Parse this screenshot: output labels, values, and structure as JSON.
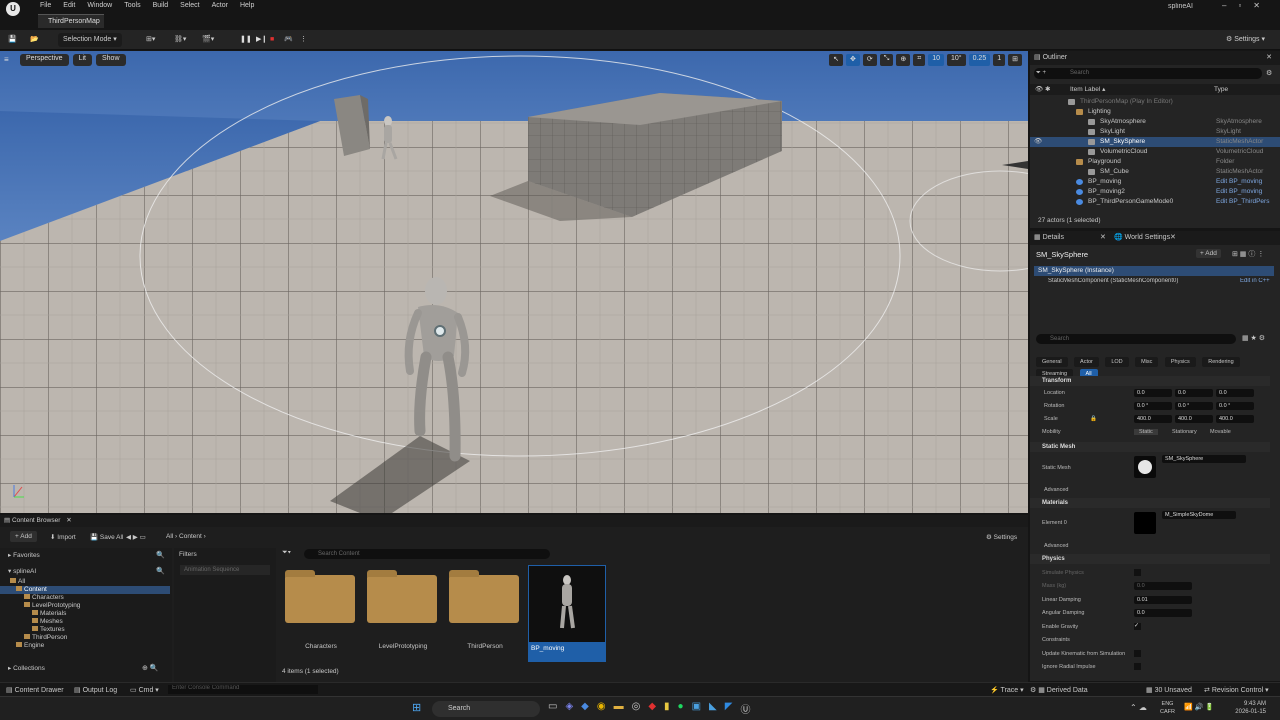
{
  "app": {
    "menus": [
      "File",
      "Edit",
      "Window",
      "Tools",
      "Build",
      "Select",
      "Actor",
      "Help"
    ],
    "map_tab": "ThirdPersonMap",
    "project": "splineAI",
    "window_controls": [
      "–",
      "▫",
      "✕"
    ]
  },
  "toolbar": {
    "selection_mode": "Selection Mode",
    "settings": "Settings"
  },
  "viewport": {
    "perspective": "Perspective",
    "lit": "Lit",
    "show": "Show",
    "grid": "10",
    "angle": "10°",
    "scale": "0.25",
    "cam": "1"
  },
  "outliner": {
    "title": "Outliner",
    "search_placeholder": "Search",
    "col_label": "Item Label ▴",
    "col_type": "Type",
    "rows": [
      {
        "label": "ThirdPersonMap (Play In Editor)",
        "type": "",
        "indent": 50,
        "icon": "🌐",
        "sel": false,
        "dim": true
      },
      {
        "label": "Lighting",
        "type": "",
        "indent": 58,
        "icon": "📁",
        "sel": false,
        "dim": false
      },
      {
        "label": "SkyAtmosphere",
        "type": "SkyAtmosphere",
        "indent": 70,
        "icon": "☁",
        "sel": false,
        "dim": false
      },
      {
        "label": "SkyLight",
        "type": "SkyLight",
        "indent": 70,
        "icon": "☀",
        "sel": false,
        "dim": false
      },
      {
        "label": "SM_SkySphere",
        "type": "StaticMeshActor",
        "indent": 70,
        "icon": "◆",
        "sel": true,
        "dim": false
      },
      {
        "label": "VolumetricCloud",
        "type": "VolumetricCloud",
        "indent": 70,
        "icon": "☁",
        "sel": false,
        "dim": false
      },
      {
        "label": "Playground",
        "type": "Folder",
        "indent": 58,
        "icon": "📁",
        "sel": false,
        "dim": false
      },
      {
        "label": "SM_Cube",
        "type": "StaticMeshActor",
        "indent": 70,
        "icon": "◆",
        "sel": false,
        "dim": false
      },
      {
        "label": "BP_moving",
        "type": "Edit BP_moving",
        "indent": 58,
        "icon": "●",
        "sel": false,
        "dim": false,
        "link": true
      },
      {
        "label": "BP_moving2",
        "type": "Edit BP_moving",
        "indent": 58,
        "icon": "●",
        "sel": false,
        "dim": false,
        "link": true
      },
      {
        "label": "BP_ThirdPersonGameMode0",
        "type": "Edit BP_ThirdPers",
        "indent": 58,
        "icon": "●",
        "sel": false,
        "dim": false,
        "link": true
      }
    ],
    "footer": "27 actors (1 selected)"
  },
  "details": {
    "tab_details": "Details",
    "tab_world": "World Settings",
    "actor_name": "SM_SkySphere",
    "add": "+ Add",
    "instance": "SM_SkySphere (Instance)",
    "component": "StaticMeshComponent (StaticMeshComponent0)",
    "edit_cpp": "Edit in C++",
    "search_placeholder": "Search",
    "filters": [
      "General",
      "Actor",
      "LOD",
      "Misc",
      "Physics",
      "Rendering",
      "Streaming",
      "All"
    ],
    "transform": "Transform",
    "location": "Location",
    "rotation": "Rotation",
    "scale": "Scale",
    "loc_vals": [
      "0.0",
      "0.0",
      "0.0"
    ],
    "rot_vals": [
      "0.0 °",
      "0.0 °",
      "0.0 °"
    ],
    "scale_vals": [
      "400.0",
      "400.0",
      "400.0"
    ],
    "mobility": "Mobility",
    "mob_opts": [
      "Static",
      "Stationary",
      "Movable"
    ],
    "static_mesh_sec": "Static Mesh",
    "static_mesh_lbl": "Static Mesh",
    "static_mesh_val": "SM_SkySphere",
    "advanced": "Advanced",
    "materials_sec": "Materials",
    "element0": "Element 0",
    "material_val": "M_SimpleSkyDome",
    "advanced2": "Advanced",
    "physics_sec": "Physics",
    "sim_physics": "Simulate Physics",
    "mass": "Mass (kg)",
    "mass_val": "0.0",
    "linear": "Linear Damping",
    "linear_val": "0.01",
    "angular": "Angular Damping",
    "angular_val": "0.0",
    "gravity": "Enable Gravity",
    "constraints": "Constraints",
    "update_kin": "Update Kinematic from Simulation",
    "ignore_radial": "Ignore Radial Impulse"
  },
  "content_browser": {
    "title": "Content Browser",
    "add": "+ Add",
    "import": "Import",
    "save_all": "Save All",
    "crumb_all": "All",
    "crumb_content": "Content",
    "settings": "Settings",
    "favorites": "Favorites",
    "project": "splineAI",
    "tree": [
      "All",
      "Content",
      "Characters",
      "LevelPrototyping",
      "Materials",
      "Meshes",
      "Textures",
      "ThirdPerson",
      "Engine"
    ],
    "collections": "Collections",
    "filters": "Filters",
    "filter_chip": "Animation Sequence",
    "search_placeholder": "Search Content",
    "assets": [
      "Characters",
      "LevelPrototyping",
      "ThirdPerson",
      "BP_moving"
    ],
    "count": "4 items (1 selected)"
  },
  "statusbar": {
    "content_drawer": "Content Drawer",
    "output_log": "Output Log",
    "cmd": "Cmd",
    "console_placeholder": "Enter Console Command",
    "trace": "Trace",
    "derived": "Derived Data",
    "unsaved": "30 Unsaved",
    "revision": "Revision Control"
  },
  "taskbar": {
    "search": "Search",
    "lang": "ENG",
    "region": "CAFR",
    "time": "9:43 AM",
    "date": "2026-01-15"
  }
}
